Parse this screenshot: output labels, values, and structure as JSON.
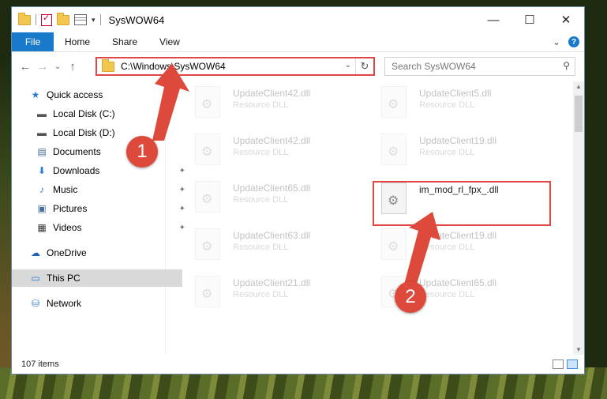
{
  "window": {
    "title": "SysWOW64",
    "controls": [
      "—",
      "☐",
      "✕"
    ]
  },
  "ribbon": {
    "tabs": [
      "File",
      "Home",
      "Share",
      "View"
    ],
    "collapse_glyph": "⌄",
    "help_glyph": "?"
  },
  "nav": {
    "back": "←",
    "forward": "→",
    "recent": "⌄",
    "up": "↑"
  },
  "address": {
    "path": "C:\\Windows\\SysWOW64",
    "dropdown": "⌄",
    "refresh": "↻"
  },
  "search": {
    "placeholder": "Search SysWOW64",
    "icon": "⚲"
  },
  "sidebar": {
    "items": [
      {
        "label": "Quick access",
        "icon": "star-icon",
        "glyph": "★",
        "color": "#2a7ad5",
        "pinned": false
      },
      {
        "label": "Local Disk (C:)",
        "icon": "drive-icon",
        "glyph": "▬",
        "color": "#555555",
        "pinned": false
      },
      {
        "label": "Local Disk (D:)",
        "icon": "drive-icon",
        "glyph": "▬",
        "color": "#555555",
        "pinned": false
      },
      {
        "label": "Documents",
        "icon": "documents-icon",
        "glyph": "▤",
        "color": "#4a6e9a",
        "pinned": false
      },
      {
        "label": "Downloads",
        "icon": "download-icon",
        "glyph": "⬇",
        "color": "#2a7ad5",
        "pinned": true
      },
      {
        "label": "Music",
        "icon": "music-icon",
        "glyph": "♪",
        "color": "#2a7ad5",
        "pinned": true
      },
      {
        "label": "Pictures",
        "icon": "pictures-icon",
        "glyph": "▣",
        "color": "#4a6e9a",
        "pinned": true
      },
      {
        "label": "Videos",
        "icon": "videos-icon",
        "glyph": "▦",
        "color": "#333333",
        "pinned": true
      },
      {
        "label": "OneDrive",
        "icon": "cloud-icon",
        "glyph": "☁",
        "color": "#1c62b9",
        "pinned": false
      },
      {
        "label": "This PC",
        "icon": "computer-icon",
        "glyph": "▭",
        "color": "#2a7ad5",
        "pinned": false
      },
      {
        "label": "Network",
        "icon": "network-icon",
        "glyph": "⛁",
        "color": "#2a7ad5",
        "pinned": false
      }
    ],
    "pin_glyph": "📌"
  },
  "files": [
    {
      "name": "UpdateClient42.dll",
      "type": "Resource DLL",
      "faded": true
    },
    {
      "name": "UpdateClient5.dll",
      "type": "Resource DLL",
      "faded": true
    },
    {
      "name": "UpdateClient42.dll",
      "type": "Resource DLL",
      "faded": true
    },
    {
      "name": "UpdateClient19.dll",
      "type": "Resource DLL",
      "faded": true
    },
    {
      "name": "UpdateClient65.dll",
      "type": "Resource DLL",
      "faded": true
    },
    {
      "name": "im_mod_rl_fpx_.dll",
      "type": "",
      "faded": false
    },
    {
      "name": "UpdateClient63.dll",
      "type": "Resource DLL",
      "faded": true
    },
    {
      "name": "UpdateClient19.dll",
      "type": "Resource DLL",
      "faded": true
    },
    {
      "name": "UpdateClient21.dll",
      "type": "Resource DLL",
      "faded": true
    },
    {
      "name": "UpdateClient65.dll",
      "type": "Resource DLL",
      "faded": true
    }
  ],
  "status": {
    "count": "107 items"
  },
  "annotations": {
    "step1": "1",
    "step2": "2",
    "highlight_color": "#e04646"
  }
}
